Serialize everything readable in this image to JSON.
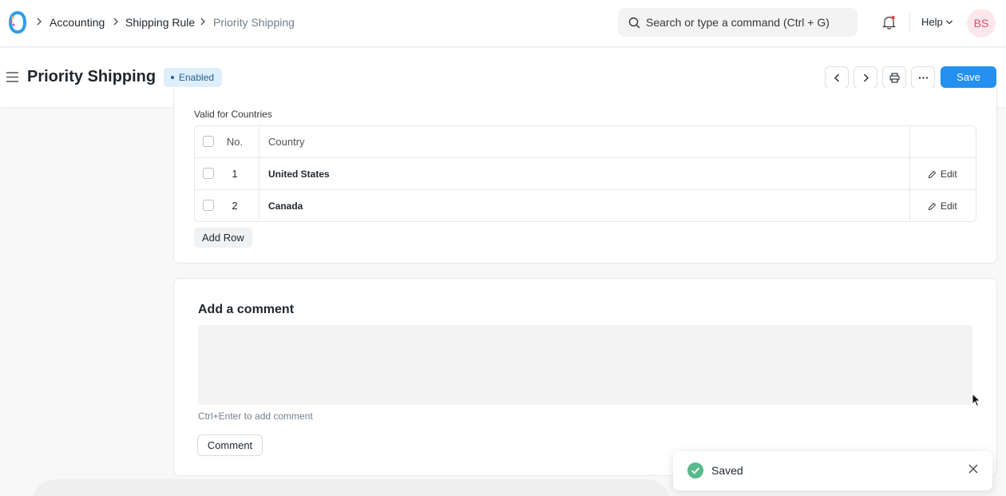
{
  "navbar": {
    "breadcrumbs": [
      "Accounting",
      "Shipping Rule",
      "Priority Shipping"
    ],
    "search_placeholder": "Search or type a command (Ctrl + G)",
    "help_label": "Help",
    "avatar_initials": "BS"
  },
  "page": {
    "title": "Priority Shipping",
    "status": "Enabled",
    "save_label": "Save"
  },
  "countries": {
    "section_label": "Valid for Countries",
    "headers": {
      "no": "No.",
      "country": "Country"
    },
    "rows": [
      {
        "no": "1",
        "country": "United States",
        "edit": "Edit"
      },
      {
        "no": "2",
        "country": "Canada",
        "edit": "Edit"
      }
    ],
    "add_row_label": "Add Row"
  },
  "comment": {
    "title": "Add a comment",
    "hint": "Ctrl+Enter to add comment",
    "button_label": "Comment"
  },
  "toast": {
    "message": "Saved"
  },
  "colors": {
    "primary": "#2490ef",
    "success": "#59ba8b",
    "status_bg": "#ddeefc"
  }
}
